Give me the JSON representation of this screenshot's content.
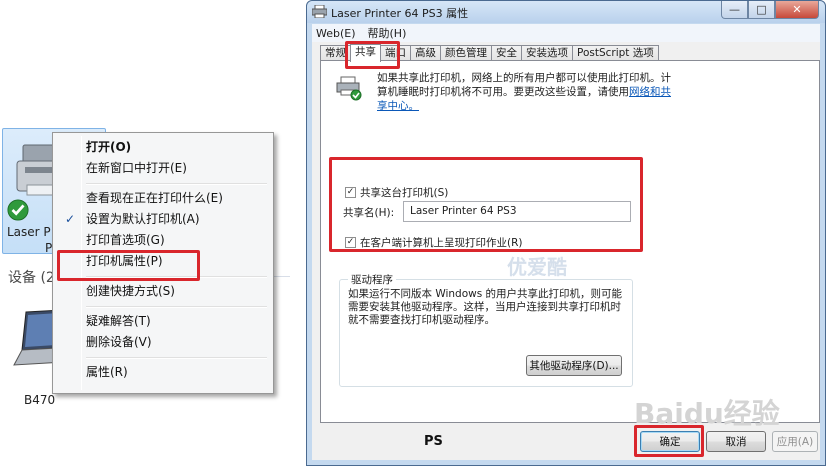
{
  "devices": {
    "printer_label_line1": "Laser P",
    "printer_label_line2": "P",
    "section_label": "设备 (2",
    "laptop_label": "B470"
  },
  "context_menu": {
    "items": [
      {
        "label": "打开(O)",
        "bold": true
      },
      {
        "label": "在新窗口中打开(E)"
      },
      {
        "label": "查看现在正在打印什么(E)"
      },
      {
        "label": "设置为默认打印机(A)",
        "checked": true,
        "check": "✓"
      },
      {
        "label": "打印首选项(G)"
      },
      {
        "label": "打印机属性(P)",
        "highlighted": true
      },
      {
        "label": "创建快捷方式(S)"
      },
      {
        "label": "疑难解答(T)"
      },
      {
        "label": "删除设备(V)"
      },
      {
        "label": "属性(R)"
      }
    ]
  },
  "window": {
    "title": "Laser Printer 64 PS3 属性",
    "controls": {
      "minimize": "—",
      "maximize": "□",
      "close": "✕"
    },
    "menu": [
      "Web(E)",
      "帮助(H)"
    ],
    "tabs": [
      "常规",
      "共享",
      "端口",
      "高级",
      "颜色管理",
      "安全",
      "安装选项",
      "PostScript 选项"
    ],
    "active_tab": "共享",
    "share_desc": "如果共享此打印机，网络上的所有用户都可以使用此打印机。计算机睡眠时打印机将不可用。要更改这些设置，请使用",
    "share_link": "网络和共享中心。",
    "share_checkbox": "共享这台打印机(S)",
    "share_name_label": "共享名(H):",
    "share_name_value": "Laser Printer 64 PS3",
    "render_checkbox": "在客户端计算机上呈现打印作业(R)",
    "check_mark": "✓",
    "drivers_title": "驱动程序",
    "drivers_text": "如果运行不同版本 Windows 的用户共享此打印机，则可能需要安装其他驱动程序。这样，当用户连接到共享打印机时就不需要查找打印机驱动程序。",
    "other_drivers_button": "其他驱动程序(D)...",
    "footer_label": "PS",
    "ok_button": "确定",
    "cancel_button": "取消",
    "apply_button": "应用(A)"
  },
  "watermarks": {
    "center": "优爱酷",
    "brand": "Baidu经验"
  },
  "colors": {
    "highlight_red": "#d9262c",
    "link_blue": "#0b58b8"
  }
}
